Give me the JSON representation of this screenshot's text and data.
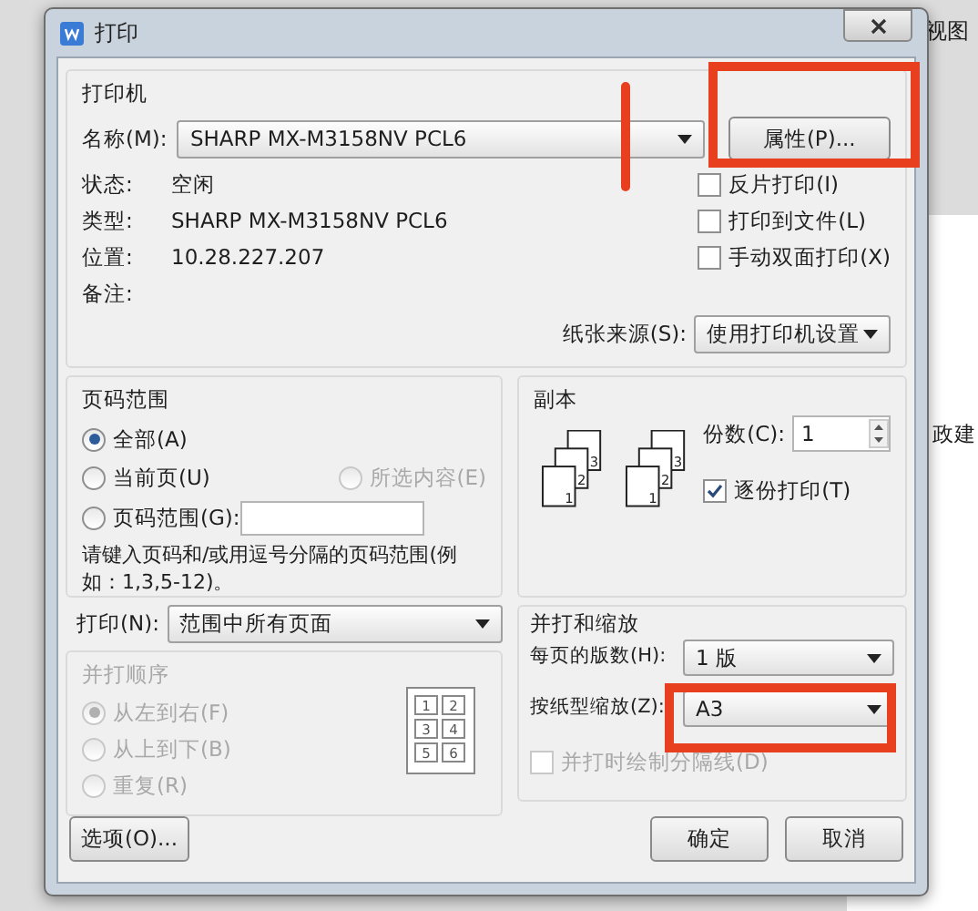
{
  "window": {
    "title": "打印"
  },
  "background": {
    "menu_tab": "视图",
    "doc_text": "政建"
  },
  "printer": {
    "group_label": "打印机",
    "name_label": "名称(M):",
    "name_value": "SHARP MX-M3158NV PCL6",
    "properties_button": "属性(P)...",
    "info": [
      {
        "label": "状态:",
        "value": "空闲"
      },
      {
        "label": "类型:",
        "value": "SHARP MX-M3158NV PCL6"
      },
      {
        "label": "位置:",
        "value": "10.28.227.207"
      },
      {
        "label": "备注:"
      }
    ],
    "options": [
      {
        "label": "反片打印(I)",
        "checked": false
      },
      {
        "label": "打印到文件(L)",
        "checked": false
      },
      {
        "label": "手动双面打印(X)",
        "checked": false
      }
    ],
    "paper_source": {
      "label": "纸张来源(S):",
      "value": "使用打印机设置"
    }
  },
  "page_range": {
    "group_label": "页码范围",
    "choices": [
      {
        "label": "全部(A)",
        "selected": true,
        "disabled": false
      },
      {
        "label": "当前页(U)",
        "selected": false,
        "disabled": false
      },
      {
        "label": "所选内容(E)",
        "selected": false,
        "disabled": true
      },
      {
        "label": "页码范围(G):",
        "selected": false,
        "disabled": false
      }
    ],
    "hint": "请键入页码和/或用逗号分隔的页码范围(例如：1,3,5-12)。"
  },
  "copies": {
    "group_label": "副本",
    "count_label": "份数(C):",
    "count": "1",
    "stacks": [
      [
        "1",
        "2",
        "3"
      ],
      [
        "1",
        "2",
        "3"
      ]
    ],
    "collate": {
      "label": "逐份打印(T)",
      "checked": true
    }
  },
  "print_what": {
    "label": "打印(N):",
    "value": "范围中所有页面"
  },
  "order": {
    "group_label": "并打顺序",
    "disabled": true,
    "choices": [
      {
        "label": "从左到右(F)",
        "selected": true
      },
      {
        "label": "从上到下(B)",
        "selected": false
      },
      {
        "label": "重复(R)",
        "selected": false
      }
    ],
    "preview_pages": [
      "1",
      "2",
      "3",
      "4",
      "5",
      "6"
    ]
  },
  "zoom": {
    "group_label": "并打和缩放",
    "pages_per_sheet": {
      "label": "每页的版数(H):",
      "value": "1 版"
    },
    "scale_to_paper": {
      "label": "按纸型缩放(Z):",
      "value": "A3"
    },
    "draw_borders": {
      "label": "并打时绘制分隔线(D)",
      "checked": false,
      "disabled": true
    }
  },
  "buttons": [
    {
      "label": "选项(O)..."
    },
    {
      "label": "确定"
    },
    {
      "label": "取消"
    }
  ]
}
